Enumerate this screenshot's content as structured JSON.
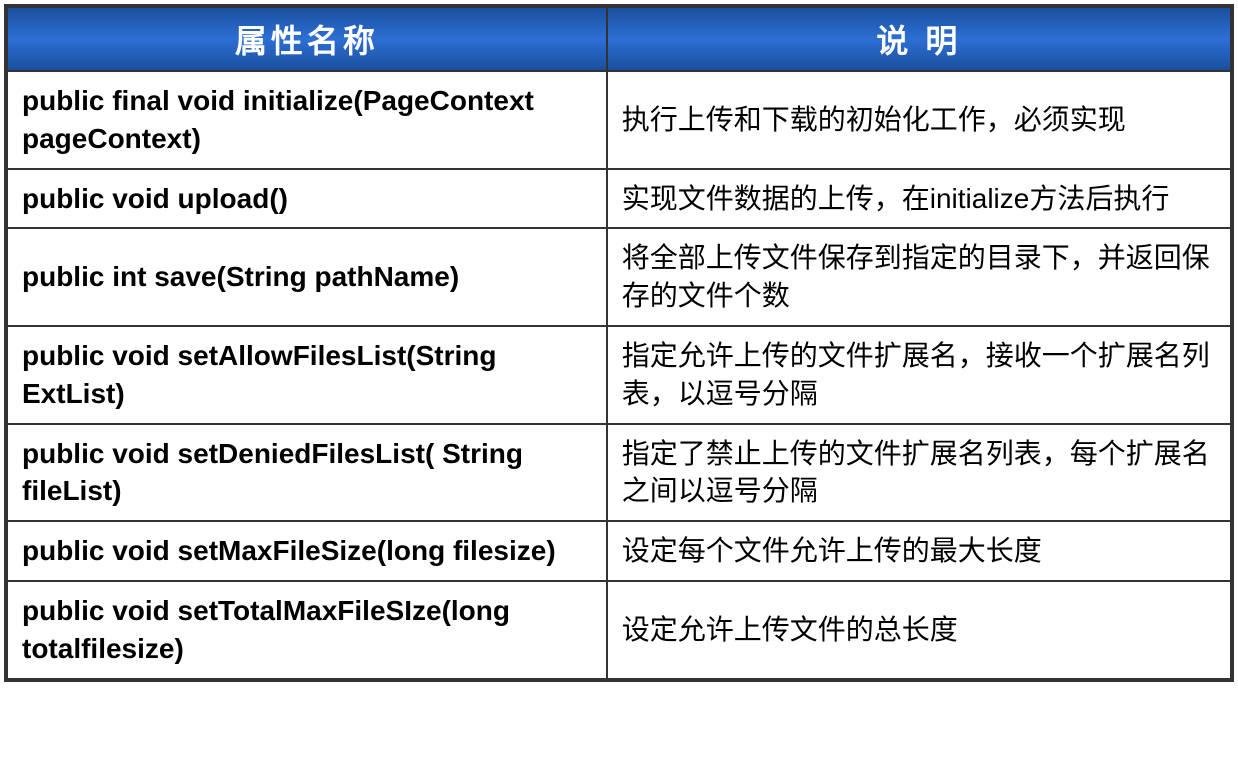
{
  "headers": {
    "col1": "属性名称",
    "col2": "说 明"
  },
  "rows": [
    {
      "method": "public final void initialize(PageContext pageContext)",
      "description": "执行上传和下载的初始化工作，必须实现"
    },
    {
      "method": "public void upload()",
      "description": "实现文件数据的上传，在initialize方法后执行"
    },
    {
      "method": "public int save(String pathName)",
      "description": "将全部上传文件保存到指定的目录下，并返回保存的文件个数"
    },
    {
      "method": "public void setAllowFilesList(String ExtList)",
      "description": "指定允许上传的文件扩展名，接收一个扩展名列表，以逗号分隔"
    },
    {
      "method": "public void setDeniedFilesList( String  fileList)",
      "description": "指定了禁止上传的文件扩展名列表，每个扩展名之间以逗号分隔"
    },
    {
      "method": "public void setMaxFileSize(long filesize)",
      "description": "设定每个文件允许上传的最大长度"
    },
    {
      "method": "public  void setTotalMaxFileSIze(long totalfilesize)",
      "description": "设定允许上传文件的总长度"
    }
  ]
}
